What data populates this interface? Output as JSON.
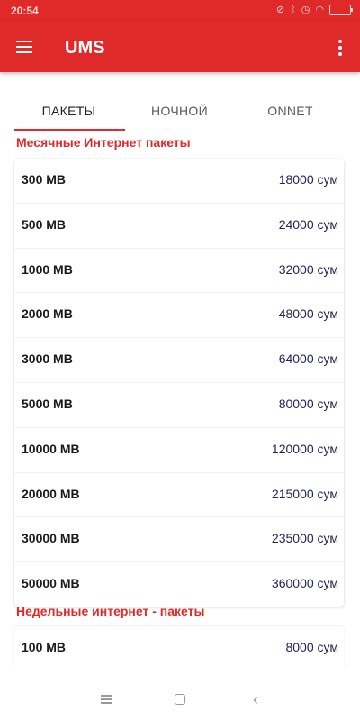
{
  "status_bar": {
    "time": "20:54",
    "icons": [
      "mute-icon",
      "bluetooth-icon",
      "alarm-icon",
      "wifi-icon",
      "battery-icon"
    ]
  },
  "app_bar": {
    "title": "UMS"
  },
  "tabs": [
    {
      "label": "ПАКЕТЫ",
      "active": true
    },
    {
      "label": "НОЧНОЙ",
      "active": false
    },
    {
      "label": "ONNET",
      "active": false
    }
  ],
  "monthly": {
    "title": "Месячные Интернет пакеты",
    "items": [
      {
        "mb": "300 MB",
        "price": "18000 сум"
      },
      {
        "mb": "500 MB",
        "price": "24000 сум"
      },
      {
        "mb": "1000 MB",
        "price": "32000 сум"
      },
      {
        "mb": "2000 MB",
        "price": "48000 сум"
      },
      {
        "mb": "3000 MB",
        "price": "64000 сум"
      },
      {
        "mb": "5000 MB",
        "price": "80000 сум"
      },
      {
        "mb": "10000 MB",
        "price": "120000 сум"
      },
      {
        "mb": "20000 MB",
        "price": "215000 сум"
      },
      {
        "mb": "30000 MB",
        "price": "235000 сум"
      },
      {
        "mb": "50000 MB",
        "price": "360000 сум"
      }
    ]
  },
  "weekly": {
    "title": "Недельные интернет - пакеты",
    "items": [
      {
        "mb": "100 MB",
        "price": "8000 сум"
      }
    ]
  },
  "colors": {
    "accent": "#e02a2a",
    "price_text": "#23235a"
  }
}
